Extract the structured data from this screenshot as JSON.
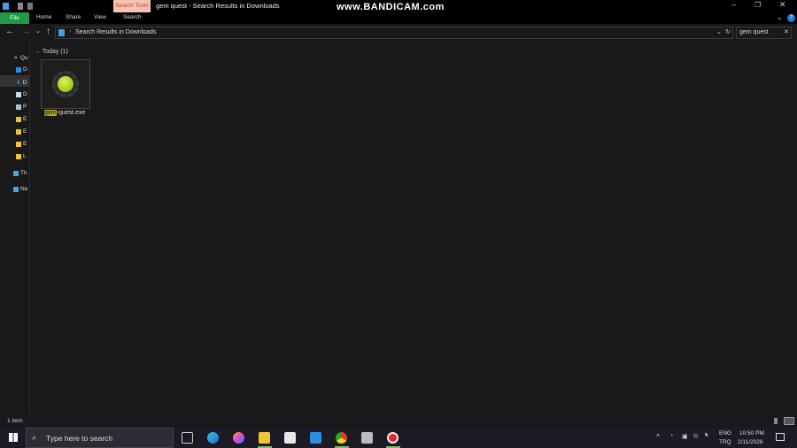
{
  "window": {
    "title": "gem quest - Search Results in Downloads",
    "context_tab": "Search Tools",
    "watermark": "www.BANDICAM.com"
  },
  "ribbon": {
    "tabs": [
      "File",
      "Home",
      "Share",
      "View",
      "Search"
    ]
  },
  "address": {
    "path": "Search Results in Downloads",
    "search_value": "gem quest"
  },
  "sidebar": {
    "items": [
      "Qu",
      "D",
      "D",
      "D",
      "P",
      "E",
      "E",
      "E",
      "L",
      "Th",
      "Ne"
    ]
  },
  "content": {
    "group": "Today (1)",
    "file": {
      "highlight": "gem",
      "rest": "-quest.exe"
    }
  },
  "status": {
    "count": "1 item"
  },
  "taskbar": {
    "search_placeholder": "Type here to search",
    "lang1": "ENG",
    "lang2": "TRQ",
    "time": "10:50 PM",
    "date": "2/11/2026"
  },
  "colors": {
    "file_tab": "#1f9a47",
    "context_tab": "#f8c3ae",
    "highlight": "#b5a42a",
    "gem": "#a5d21e"
  }
}
